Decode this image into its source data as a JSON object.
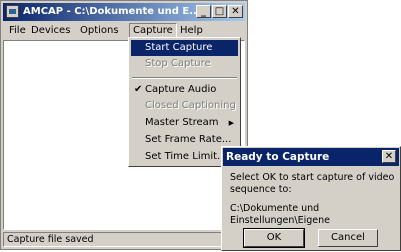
{
  "window": {
    "title": "AMCAP - C:\\Dokumente und E...",
    "minimize_glyph": "_",
    "maximize_glyph": "□",
    "close_glyph": "✕"
  },
  "menubar": {
    "items": [
      {
        "label": "File"
      },
      {
        "label": "Devices"
      },
      {
        "label": "Options"
      },
      {
        "label": "Capture"
      },
      {
        "label": "Help"
      }
    ]
  },
  "capture_menu": {
    "items": [
      {
        "label": "Start Capture",
        "state": "highlighted"
      },
      {
        "label": "Stop Capture",
        "state": "disabled"
      },
      {
        "label": "Capture Audio",
        "state": "checked"
      },
      {
        "label": "Closed Captioning",
        "state": "disabled"
      },
      {
        "label": "Master Stream",
        "state": "submenu"
      },
      {
        "label": "Set Frame Rate...",
        "state": "normal"
      },
      {
        "label": "Set Time Limit...",
        "state": "normal"
      }
    ],
    "check_glyph": "✔",
    "submenu_glyph": "▶"
  },
  "status": {
    "text": "Capture file saved"
  },
  "dialog": {
    "title": "Ready to Capture",
    "close_glyph": "✕",
    "message": "Select OK to start capture of video sequence to:",
    "path_line1": "C:\\Dokumente und",
    "path_line2": "Einstellungen\\Eigene",
    "ok_label": "OK",
    "cancel_label": "Cancel"
  },
  "colors": {
    "titlebar_active": "#0a246a",
    "face": "#d4d0c8",
    "highlight": "#0a246a"
  }
}
